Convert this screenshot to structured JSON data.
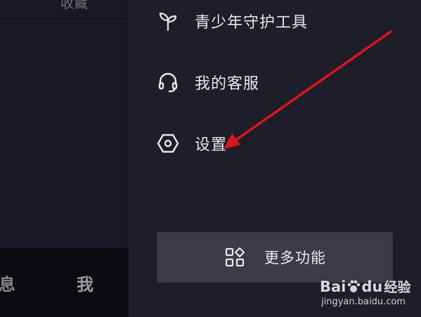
{
  "background_screen": {
    "top_partial_text": "收藏",
    "bottom_tabs": {
      "messages_partial": "息",
      "me": "我"
    }
  },
  "drawer": {
    "items": [
      {
        "icon": "sprout-icon",
        "label": "青少年守护工具"
      },
      {
        "icon": "headset-icon",
        "label": "我的客服"
      },
      {
        "icon": "settings-hexagon-icon",
        "label": "设置"
      }
    ],
    "more_button": {
      "icon": "grid-apps-icon",
      "label": "更多功能"
    }
  },
  "annotation": {
    "arrow_color": "#e0131a"
  },
  "watermark": {
    "logo_text": "Bai",
    "logo_text_suffix": "du",
    "logo_cn": "经验",
    "url": "jingyan.baidu.com"
  },
  "colors": {
    "drawer_bg": "#1d1e29",
    "button_bg": "#3a3b46",
    "text_primary": "#e8e8ec"
  }
}
